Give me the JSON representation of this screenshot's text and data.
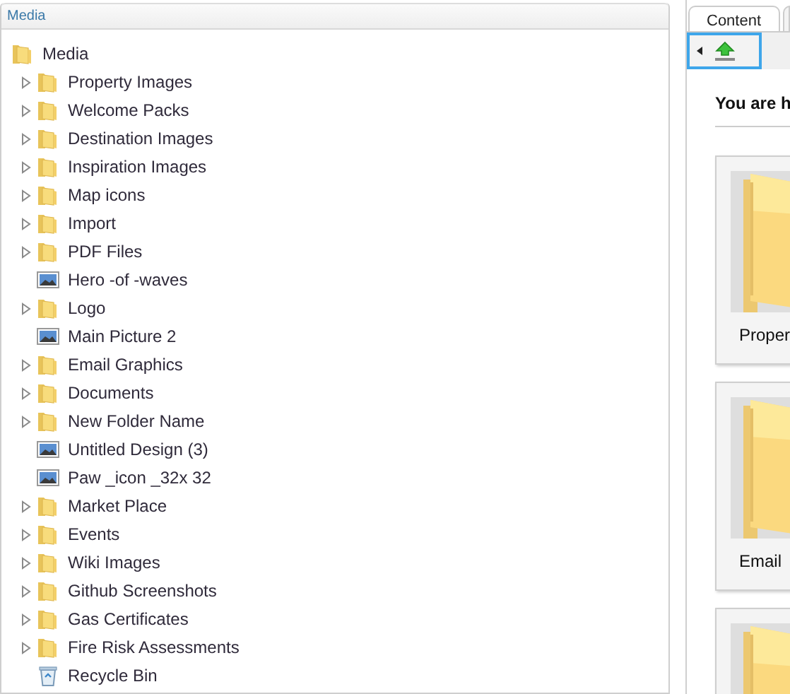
{
  "media_panel": {
    "title": "Media",
    "tree": [
      {
        "label": "Media",
        "kind": "folder",
        "children": [
          {
            "label": "Property Images",
            "kind": "folder",
            "expandable": true
          },
          {
            "label": "Welcome Packs",
            "kind": "folder",
            "expandable": true
          },
          {
            "label": "Destination Images",
            "kind": "folder",
            "expandable": true
          },
          {
            "label": "Inspiration Images",
            "kind": "folder",
            "expandable": true
          },
          {
            "label": "Map icons",
            "kind": "folder",
            "expandable": true
          },
          {
            "label": "Import",
            "kind": "folder",
            "expandable": true
          },
          {
            "label": "PDF Files",
            "kind": "folder",
            "expandable": true
          },
          {
            "label": "Hero -of -waves",
            "kind": "image",
            "expandable": false
          },
          {
            "label": "Logo",
            "kind": "folder",
            "expandable": true
          },
          {
            "label": "Main Picture 2",
            "kind": "image",
            "expandable": false
          },
          {
            "label": "Email Graphics",
            "kind": "folder",
            "expandable": true
          },
          {
            "label": "Documents",
            "kind": "folder",
            "expandable": true
          },
          {
            "label": "New Folder Name",
            "kind": "folder",
            "expandable": true
          },
          {
            "label": "Untitled Design (3)",
            "kind": "image",
            "expandable": false
          },
          {
            "label": "Paw _icon _32x 32",
            "kind": "image",
            "expandable": false
          },
          {
            "label": "Market Place",
            "kind": "folder",
            "expandable": true
          },
          {
            "label": "Events",
            "kind": "folder",
            "expandable": true
          },
          {
            "label": "Wiki Images",
            "kind": "folder",
            "expandable": true
          },
          {
            "label": "Github Screenshots",
            "kind": "folder",
            "expandable": true
          },
          {
            "label": "Gas Certificates",
            "kind": "folder",
            "expandable": true
          },
          {
            "label": "Fire Risk Assessments",
            "kind": "folder",
            "expandable": true
          },
          {
            "label": "Recycle Bin",
            "kind": "bin",
            "expandable": false
          }
        ]
      }
    ]
  },
  "content_panel": {
    "tabs": [
      {
        "label": "Content",
        "selected": true
      }
    ],
    "intro": "You are h",
    "cards": [
      {
        "label": "Proper",
        "kind": "folder"
      },
      {
        "label": "Email",
        "kind": "folder"
      },
      {
        "kind": "folder"
      }
    ]
  }
}
